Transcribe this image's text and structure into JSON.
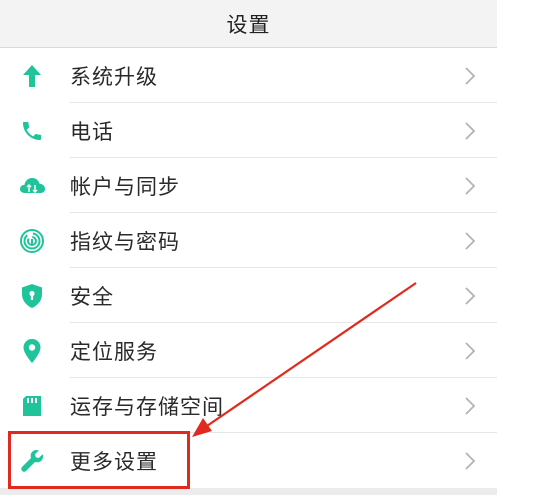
{
  "header": {
    "title": "设置"
  },
  "settings": {
    "items": [
      {
        "label": "系统升级",
        "icon": "arrow-up-icon"
      },
      {
        "label": "电话",
        "icon": "phone-icon"
      },
      {
        "label": "帐户与同步",
        "icon": "cloud-sync-icon"
      },
      {
        "label": "指纹与密码",
        "icon": "fingerprint-icon"
      },
      {
        "label": "安全",
        "icon": "shield-icon"
      },
      {
        "label": "定位服务",
        "icon": "location-pin-icon"
      },
      {
        "label": "运存与存储空间",
        "icon": "sd-card-icon"
      },
      {
        "label": "更多设置",
        "icon": "wrench-icon"
      }
    ]
  },
  "colors": {
    "icon_accent": "#1fc49a",
    "annotation_red": "#e02a1f",
    "chevron": "#b3b3b3"
  }
}
